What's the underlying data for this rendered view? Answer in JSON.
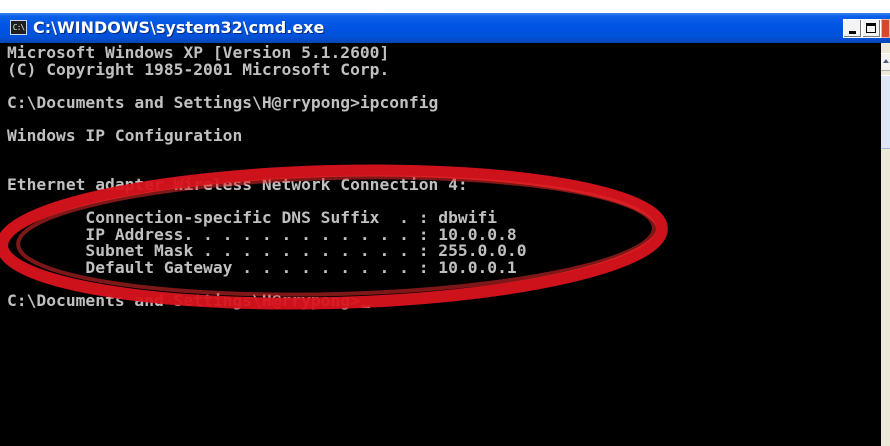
{
  "window": {
    "title": "C:\\WINDOWS\\system32\\cmd.exe",
    "icon_text": "C:\\",
    "icon": "cmd-icon",
    "buttons": [
      "minimize-icon",
      "maximize-icon",
      "close-icon"
    ]
  },
  "console": {
    "lines": [
      "Microsoft Windows XP [Version 5.1.2600]",
      "(C) Copyright 1985-2001 Microsoft Corp.",
      "",
      "C:\\Documents and Settings\\H@rrypong>ipconfig",
      "",
      "Windows IP Configuration",
      "",
      "",
      "Ethernet adapter Wireless Network Connection 4:",
      "",
      "        Connection-specific DNS Suffix  . : dbwifi",
      "        IP Address. . . . . . . . . . . . : 10.0.0.8",
      "        Subnet Mask . . . . . . . . . . . : 255.0.0.0",
      "        Default Gateway . . . . . . . . . : 10.0.0.1",
      "",
      "C:\\Documents and Settings\\H@rrypong>"
    ]
  },
  "colors": {
    "console_bg": "#000000",
    "console_text": "#c0c0c0",
    "titlebar": "#0054e3",
    "annotation_red": "#d8131c"
  }
}
